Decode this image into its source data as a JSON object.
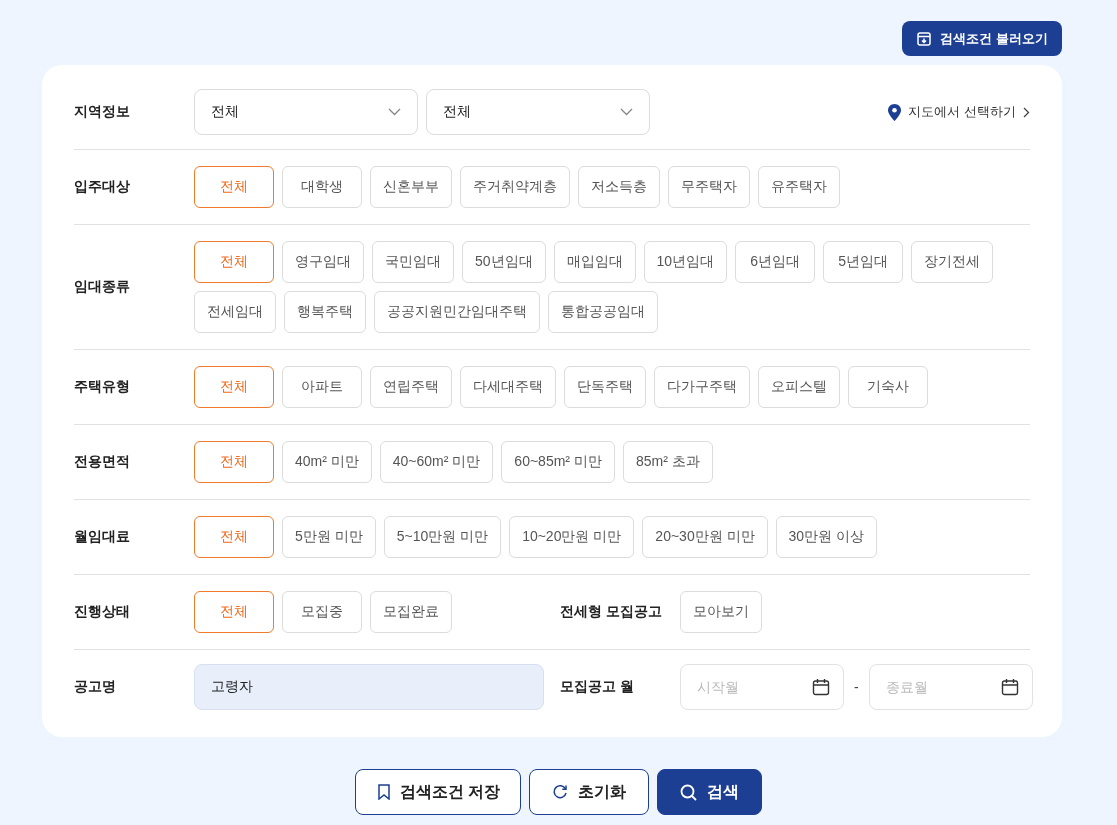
{
  "load_button": {
    "label": "검색조건 불러오기"
  },
  "filters": [
    {
      "kind": "region",
      "label": "지역정보",
      "selects": [
        {
          "value": "전체"
        },
        {
          "value": "전체"
        }
      ],
      "map_link": "지도에서 선택하기"
    },
    {
      "kind": "chips",
      "label": "입주대상",
      "options": [
        {
          "label": "전체",
          "selected": true
        },
        {
          "label": "대학생",
          "selected": false
        },
        {
          "label": "신혼부부",
          "selected": false
        },
        {
          "label": "주거취약계층",
          "selected": false
        },
        {
          "label": "저소득층",
          "selected": false
        },
        {
          "label": "무주택자",
          "selected": false
        },
        {
          "label": "유주택자",
          "selected": false
        }
      ]
    },
    {
      "kind": "chips",
      "label": "임대종류",
      "options": [
        {
          "label": "전체",
          "selected": true
        },
        {
          "label": "영구임대",
          "selected": false
        },
        {
          "label": "국민임대",
          "selected": false
        },
        {
          "label": "50년임대",
          "selected": false
        },
        {
          "label": "매입임대",
          "selected": false
        },
        {
          "label": "10년임대",
          "selected": false
        },
        {
          "label": "6년임대",
          "selected": false
        },
        {
          "label": "5년임대",
          "selected": false
        },
        {
          "label": "장기전세",
          "selected": false
        },
        {
          "label": "전세임대",
          "selected": false
        },
        {
          "label": "행복주택",
          "selected": false
        },
        {
          "label": "공공지원민간임대주택",
          "selected": false
        },
        {
          "label": "통합공공임대",
          "selected": false
        }
      ]
    },
    {
      "kind": "chips",
      "label": "주택유형",
      "options": [
        {
          "label": "전체",
          "selected": true
        },
        {
          "label": "아파트",
          "selected": false
        },
        {
          "label": "연립주택",
          "selected": false
        },
        {
          "label": "다세대주택",
          "selected": false
        },
        {
          "label": "단독주택",
          "selected": false
        },
        {
          "label": "다가구주택",
          "selected": false
        },
        {
          "label": "오피스텔",
          "selected": false
        },
        {
          "label": "기숙사",
          "selected": false
        }
      ]
    },
    {
      "kind": "chips",
      "label": "전용면적",
      "options": [
        {
          "label": "전체",
          "selected": true
        },
        {
          "label": "40m² 미만",
          "selected": false
        },
        {
          "label": "40~60m² 미만",
          "selected": false
        },
        {
          "label": "60~85m² 미만",
          "selected": false
        },
        {
          "label": "85m² 초과",
          "selected": false
        }
      ]
    },
    {
      "kind": "chips",
      "label": "월임대료",
      "options": [
        {
          "label": "전체",
          "selected": true
        },
        {
          "label": "5만원 미만",
          "selected": false
        },
        {
          "label": "5~10만원 미만",
          "selected": false
        },
        {
          "label": "10~20만원 미만",
          "selected": false
        },
        {
          "label": "20~30만원 미만",
          "selected": false
        },
        {
          "label": "30만원 이상",
          "selected": false
        }
      ]
    },
    {
      "kind": "status",
      "label": "진행상태",
      "options": [
        {
          "label": "전체",
          "selected": true
        },
        {
          "label": "모집중",
          "selected": false
        },
        {
          "label": "모집완료",
          "selected": false
        }
      ],
      "extra_label": "전세형 모집공고",
      "extra_options": [
        {
          "label": "모아보기",
          "selected": false
        }
      ]
    },
    {
      "kind": "name",
      "label": "공고명",
      "value": "고령자",
      "month_label": "모집공고 월",
      "start_placeholder": "시작월",
      "separator": "-",
      "end_placeholder": "종료월"
    }
  ],
  "actions": [
    {
      "kind": "save",
      "label": "검색조건 저장"
    },
    {
      "kind": "reset",
      "label": "초기화"
    },
    {
      "kind": "search",
      "label": "검색"
    }
  ]
}
